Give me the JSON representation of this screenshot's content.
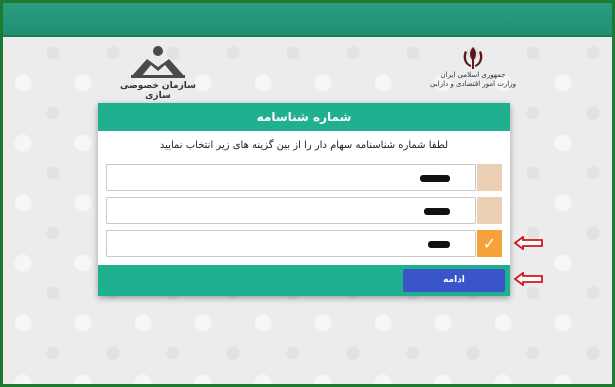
{
  "header": {
    "left_logo_caption": "سازمان خصوصی سازی",
    "right_logo_line1": "جمهوری اسلامی ایران",
    "right_logo_line2": "وزارت امور اقتصادی و دارایی"
  },
  "dialog": {
    "title": "شماره شناسامه",
    "instruction": "لطفا شماره شناسنامه سهام دار را از بین گزینه های زیر انتخاب نمایید",
    "options": [
      {
        "checked": false
      },
      {
        "checked": false
      },
      {
        "checked": true
      }
    ],
    "continue_label": "ادامه"
  },
  "colors": {
    "accent": "#1fb08f",
    "button": "#3a55c9",
    "checked": "#f6a23a",
    "unchecked": "#ecd0b6",
    "arrow": "#d0161b"
  }
}
